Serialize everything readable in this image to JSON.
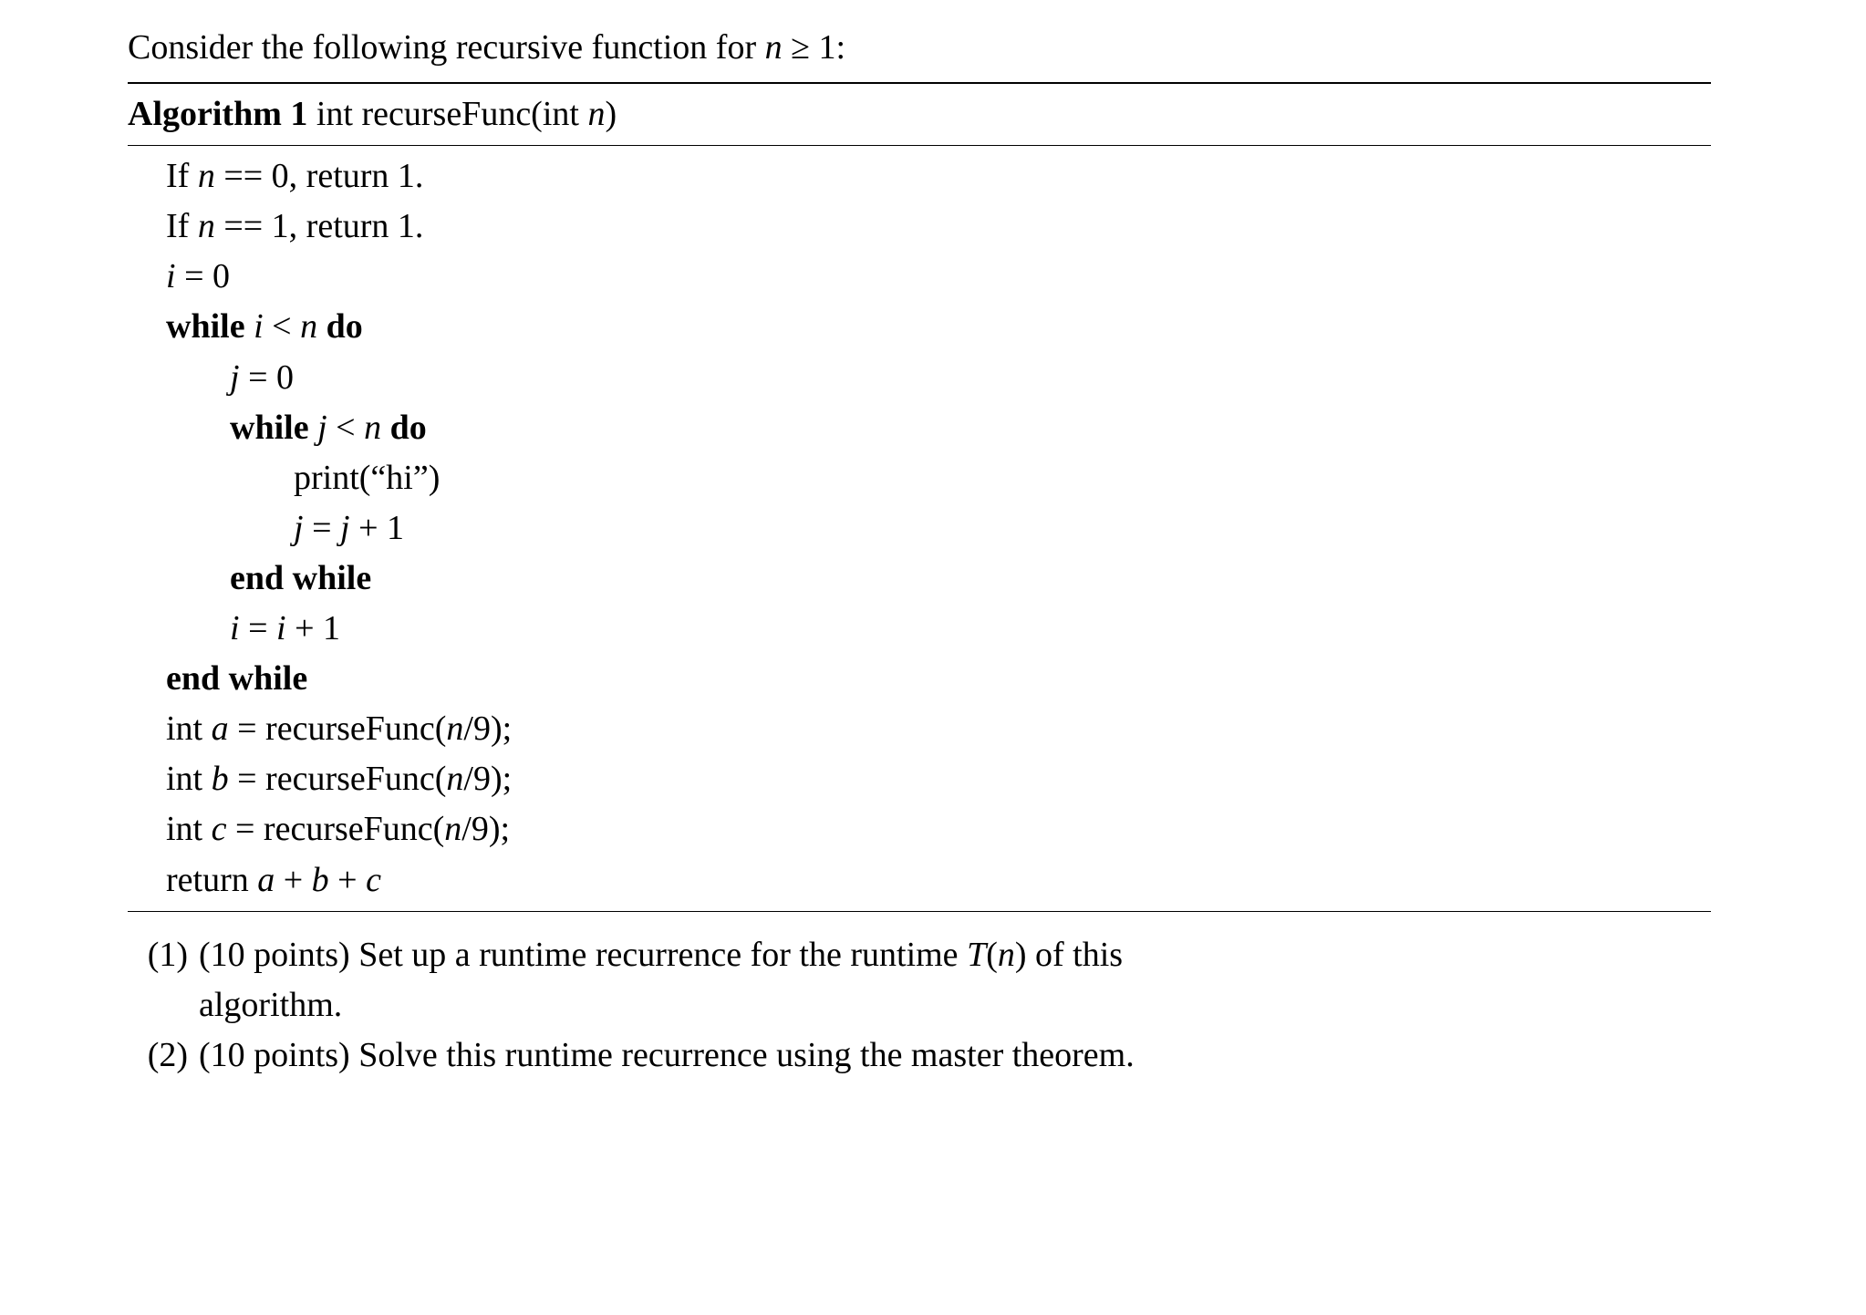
{
  "intro": {
    "prefix": "Consider the following recursive function for ",
    "var_n": "n",
    "rel": " ≥ 1:"
  },
  "algoTitle": {
    "label": "Algorithm 1",
    "sig_head": " int recurseFunc(int ",
    "sig_var": "n",
    "sig_tail": ")"
  },
  "lines": {
    "l1a": "If ",
    "l1b": "n",
    "l1c": " == 0, return 1.",
    "l2a": "If ",
    "l2b": "n",
    "l2c": " == 1, return 1.",
    "l3a": "i",
    "l3b": " = 0",
    "l4a": "while ",
    "l4b": "i",
    "l4c": " < ",
    "l4d": "n",
    "l4e": " do",
    "l5a": "j",
    "l5b": " = 0",
    "l6a": "while ",
    "l6b": "j",
    "l6c": " < ",
    "l6d": "n",
    "l6e": " do",
    "l7": "print(“hi”)",
    "l8a": "j",
    "l8b": " = ",
    "l8c": "j",
    "l8d": " + 1",
    "l9": "end while",
    "l10a": "i",
    "l10b": " = ",
    "l10c": "i",
    "l10d": " + 1",
    "l11": "end while",
    "l12a": "int ",
    "l12b": "a",
    "l12c": " = recurseFunc(",
    "l12d": "n",
    "l12e": "/9);",
    "l13a": "int ",
    "l13b": "b",
    "l13c": " = recurseFunc(",
    "l13d": "n",
    "l13e": "/9);",
    "l14a": "int ",
    "l14b": "c",
    "l14c": " = recurseFunc(",
    "l14d": "n",
    "l14e": "/9);",
    "l15a": "return ",
    "l15b": "a",
    "l15c": " + ",
    "l15d": "b",
    "l15e": " + ",
    "l15f": "c"
  },
  "q1": {
    "num": "(1)",
    "t1": "(10 points) Set up a runtime recurrence for the runtime ",
    "Tvar": "T",
    "paren_open": "(",
    "nvar": "n",
    "paren_close": ")",
    "t2": " of this",
    "t3": "algorithm."
  },
  "q2": {
    "num": "(2)",
    "t1": "(10 points) Solve this runtime recurrence using the master theorem."
  }
}
